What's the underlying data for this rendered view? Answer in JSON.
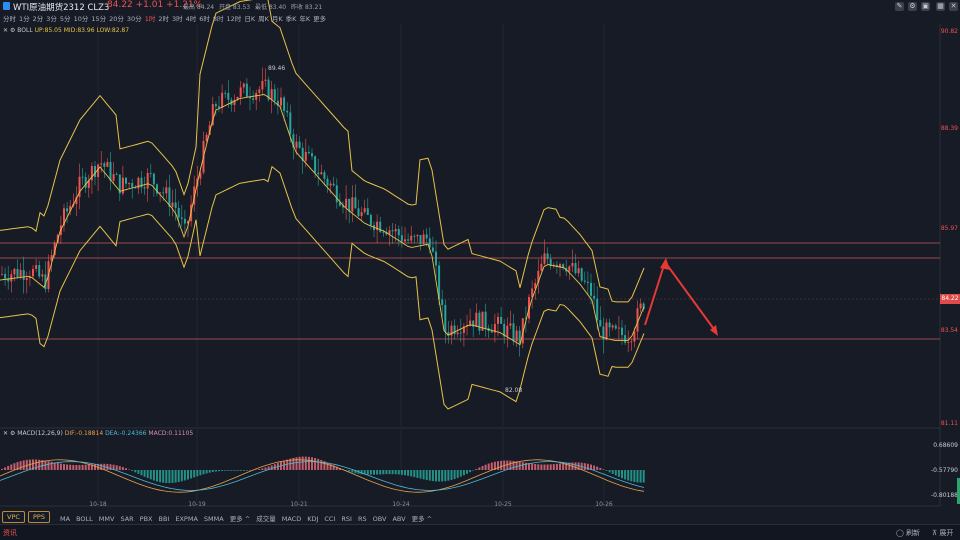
{
  "header": {
    "symbol": "WTI原油期货2312 CLZ3",
    "price_change": "84.22 +1.01 +1.21%",
    "stats": [
      "最高 84.24",
      "开盘 83.53",
      "最低 83.40",
      "昨收 83.21"
    ]
  },
  "periods": [
    "分时",
    "1分",
    "2分",
    "3分",
    "5分",
    "10分",
    "15分",
    "20分",
    "30分",
    "1时",
    "2时",
    "3时",
    "4时",
    "6时",
    "8时",
    "12时",
    "日K",
    "周K",
    "月K",
    "季K",
    "年K",
    "更多"
  ],
  "active_period": "1时",
  "boll_legend": {
    "name": "BOLL",
    "up": "UP:85.05",
    "mid": "MID:83.96",
    "low": "LOW:82.87"
  },
  "macd_legend": {
    "name": "MACD(12,26,9)",
    "dif": "DIF:-0.18814",
    "dea": "DEA:-0.24366",
    "macd": "MACD:0.11105"
  },
  "price_axis": [
    "90.82",
    "88.39",
    "85.97",
    "84.22",
    "83.54",
    "81.11"
  ],
  "macd_axis": [
    "0.68609",
    "-0.57790",
    "-0.80188"
  ],
  "date_axis": [
    "10-18",
    "10-19",
    "10-21",
    "10-24",
    "10-25",
    "10-26"
  ],
  "annotations": {
    "high_label": "89.46",
    "low_label": "82.08"
  },
  "indicator_buttons": [
    "VPC",
    "PPS"
  ],
  "indicators": [
    "MA",
    "BOLL",
    "MMV",
    "SAR",
    "PBX",
    "BBI",
    "EXPMA",
    "SMMA",
    "更多 ^",
    "成交量",
    "MACD",
    "KDJ",
    "CCI",
    "RSI",
    "RS",
    "OBV",
    "ABV",
    "更多 ^"
  ],
  "footer": {
    "news": "资讯",
    "refresh": "刷新",
    "expand": "展开"
  },
  "colors": {
    "up": "#ef5350",
    "down": "#26a69a",
    "boll": "#e6c34a",
    "hline": "#c85a5a",
    "arrow": "#e53935"
  }
}
